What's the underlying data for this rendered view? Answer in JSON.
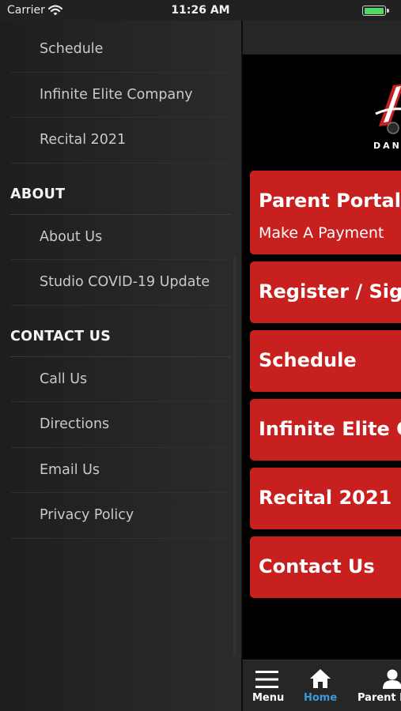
{
  "status_bar": {
    "carrier": "Carrier",
    "time": "11:26 AM",
    "battery_level": 1.0
  },
  "drawer": {
    "items_top": [
      "Schedule",
      "Infinite Elite Company",
      "Recital 2021"
    ],
    "about": {
      "header": "ABOUT",
      "items": [
        "About Us",
        "Studio COVID-19 Update"
      ]
    },
    "contact": {
      "header": "CONTACT US",
      "items": [
        "Call Us",
        "Directions",
        "Email Us",
        "Privacy Policy"
      ]
    }
  },
  "main": {
    "logo_text": "DAN",
    "cards": [
      {
        "title": "Parent Portal",
        "subtitle": "Make A Payment"
      },
      {
        "title": "Register / Sign"
      },
      {
        "title": "Schedule"
      },
      {
        "title": "Infinite Elite C"
      },
      {
        "title": "Recital 2021"
      },
      {
        "title": "Contact Us"
      }
    ]
  },
  "tabbar": {
    "menu": "Menu",
    "home": "Home",
    "parent": "Parent P"
  },
  "colors": {
    "accent_red": "#c8201f",
    "tab_active": "#3a9bdc",
    "drawer_bg": "#242424"
  }
}
